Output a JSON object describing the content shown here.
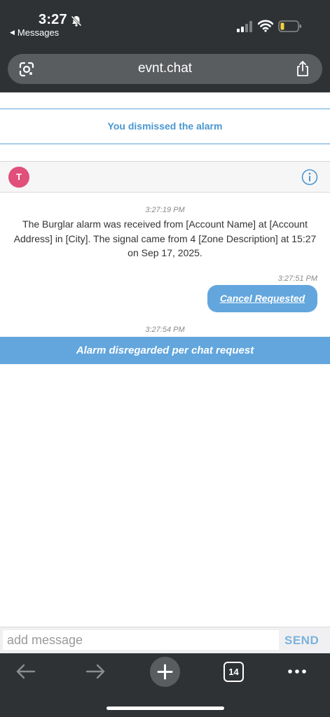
{
  "status_bar": {
    "time": "3:27",
    "back_app": "Messages"
  },
  "browser": {
    "url": "evnt.chat"
  },
  "chat": {
    "dismissed_notice": "You dismissed the alarm",
    "avatar_initial": "T",
    "messages": [
      {
        "timestamp": "3:27:19 PM",
        "text": "The Burglar alarm was received from [Account Name] at [Account Address]  in [City]. The signal came from 4 [Zone Description] at 15:27 on Sep 17, 2025."
      },
      {
        "timestamp": "3:27:51 PM",
        "text": "Cancel Requested"
      },
      {
        "timestamp": "3:27:54 PM",
        "text": "Alarm disregarded per chat request"
      }
    ]
  },
  "composer": {
    "placeholder": "add message",
    "send_label": "SEND"
  },
  "toolbar": {
    "tab_count": "14"
  },
  "colors": {
    "accent": "#62a6dd",
    "avatar": "#e0507a",
    "chrome": "#2f3235"
  }
}
